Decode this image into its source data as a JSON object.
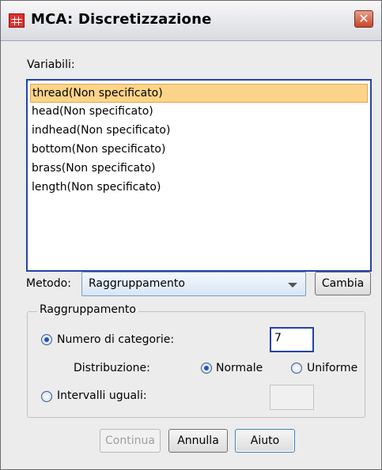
{
  "window": {
    "title": "MCA: Discretizzazione",
    "close_glyph": "✕",
    "app_icon": "spss-table-icon"
  },
  "variables": {
    "label": "Variabili:",
    "items": [
      "thread(Non specificato)",
      "head(Non specificato)",
      "indhead(Non specificato)",
      "bottom(Non specificato)",
      "brass(Non specificato)",
      "length(Non specificato)"
    ],
    "selected_index": 0
  },
  "method": {
    "label": "Metodo:",
    "value": "Raggruppamento",
    "change_button": "Cambia"
  },
  "grouping": {
    "title": "Raggruppamento",
    "num_categories_label": "Numero di categorie:",
    "num_categories_value": "7",
    "distribution_label": "Distribuzione:",
    "normal_label": "Normale",
    "uniform_label": "Uniforme",
    "equal_intervals_label": "Intervalli uguali:",
    "equal_intervals_value": ""
  },
  "buttons": {
    "continue": "Continua",
    "cancel": "Annulla",
    "help": "Aiuto"
  }
}
